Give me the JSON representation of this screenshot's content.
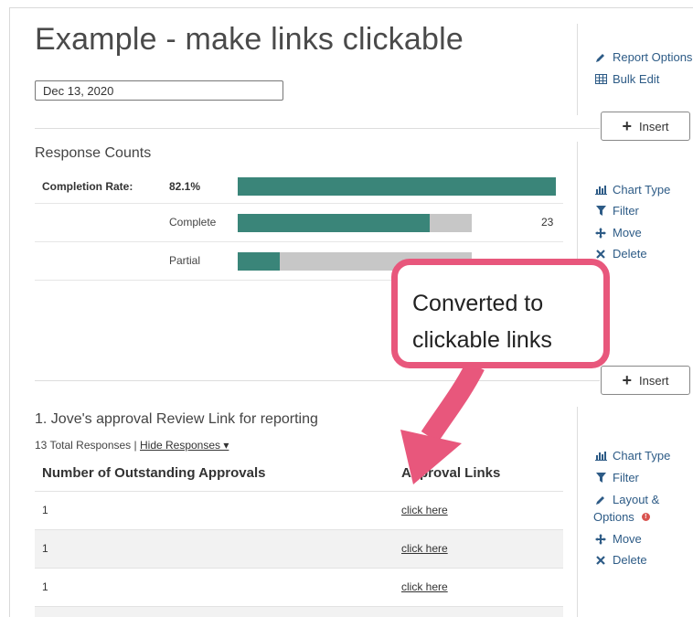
{
  "report": {
    "title": "Example - make links clickable",
    "date": "Dec 13, 2020"
  },
  "top_sidebar": {
    "report_options": "Report Options",
    "bulk_edit": "Bulk Edit"
  },
  "insert_label": "Insert",
  "response_counts": {
    "title": "Response Counts",
    "completion_label": "Completion Rate:",
    "completion_value": "82.1%",
    "completion_fraction": 1.0,
    "rows": [
      {
        "label": "Complete",
        "count": "23",
        "fill_fraction": 0.82,
        "track_fraction": 1.0
      },
      {
        "label": "Partial",
        "count": "",
        "fill_fraction": 0.18,
        "track_fraction": 1.0
      }
    ]
  },
  "chart_sidebar": {
    "chart_type": "Chart Type",
    "filter": "Filter",
    "move": "Move",
    "delete": "Delete"
  },
  "callout": {
    "line1": "Converted to",
    "line2": "clickable links",
    "border_color": "#e8577c"
  },
  "question": {
    "title": "1. Jove's approval Review Link for reporting",
    "total": "13 Total Responses |",
    "hide_link": "Hide Responses ▾",
    "col1": "Number of Outstanding Approvals",
    "col2": "Approval Links",
    "rows": [
      {
        "num": "1",
        "link": "click here"
      },
      {
        "num": "1",
        "link": "click here"
      },
      {
        "num": "1",
        "link": "click here"
      }
    ]
  },
  "question_sidebar": {
    "chart_type": "Chart Type",
    "filter": "Filter",
    "layout": "Layout &",
    "options": "Options",
    "badge": "!",
    "move": "Move",
    "delete": "Delete"
  },
  "colors": {
    "bar_fill": "#3a8579",
    "bar_track": "#c7c7c7",
    "link": "#2d5b86",
    "accent_pink": "#e8577c"
  }
}
